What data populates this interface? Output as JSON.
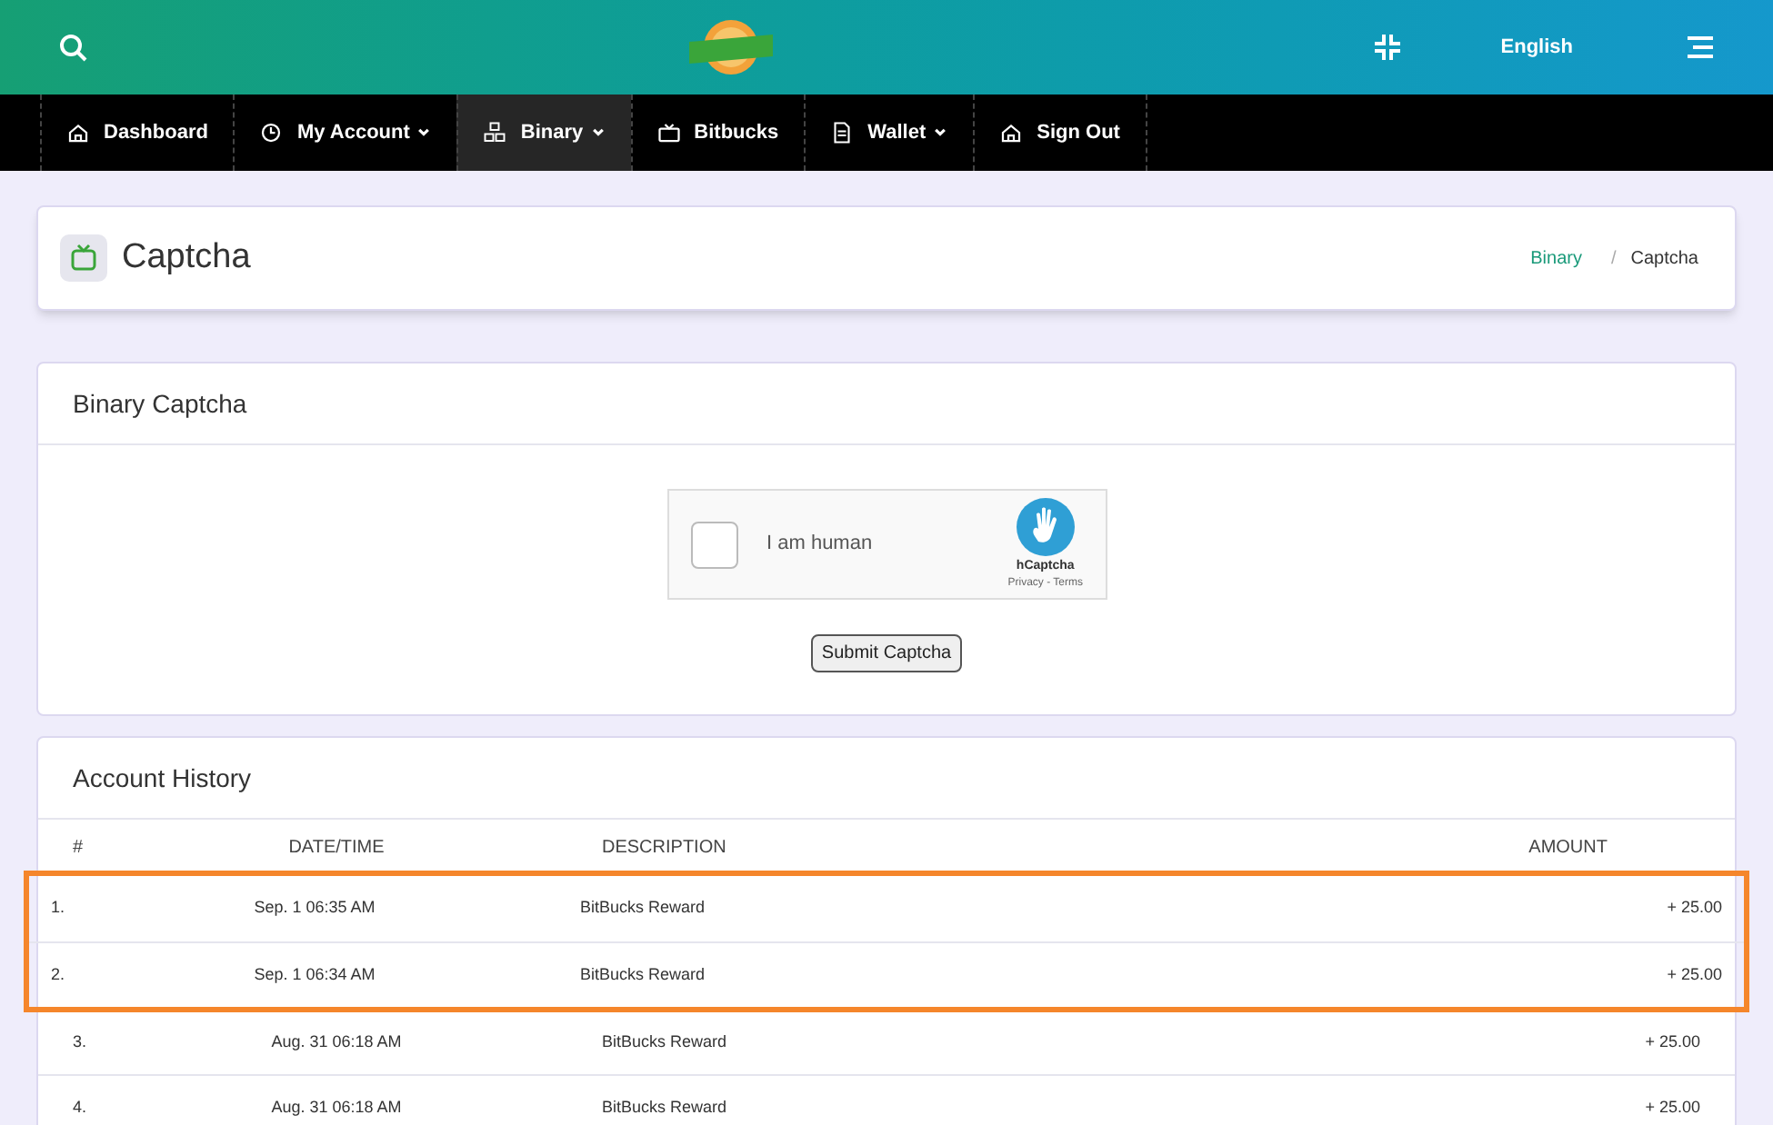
{
  "header": {
    "language": "English"
  },
  "nav": [
    {
      "label": "Dashboard",
      "kind": "home",
      "dropdown": false,
      "selected": false
    },
    {
      "label": "My Account",
      "kind": "clock",
      "dropdown": true,
      "selected": false
    },
    {
      "label": "Binary",
      "kind": "nodes",
      "dropdown": true,
      "selected": true
    },
    {
      "label": "Bitbucks",
      "kind": "tv",
      "dropdown": false,
      "selected": false
    },
    {
      "label": "Wallet",
      "kind": "doc",
      "dropdown": true,
      "selected": false
    },
    {
      "label": "Sign Out",
      "kind": "home",
      "dropdown": false,
      "selected": false
    }
  ],
  "page": {
    "title": "Captcha",
    "breadcrumb": [
      "Binary",
      "Captcha"
    ],
    "breadcrumb_separator": "/"
  },
  "captcha_card": {
    "title": "Binary Captcha",
    "checkbox_label": "I am human",
    "checked": false,
    "provider": "hCaptcha",
    "links": "Privacy - Terms",
    "button": "Submit Captcha"
  },
  "history": {
    "title": "Account History",
    "columns": [
      "#",
      "DATE/TIME",
      "DESCRIPTION",
      "AMOUNT"
    ],
    "rows": [
      {
        "num": "1.",
        "date": "Sep. 1 06:35 AM",
        "description": "BitBucks Reward",
        "amount": "+ 25.00",
        "highlighted": true
      },
      {
        "num": "2.",
        "date": "Sep. 1 06:34 AM",
        "description": "BitBucks Reward",
        "amount": "+ 25.00",
        "highlighted": true
      },
      {
        "num": "3.",
        "date": "Aug. 31 06:18 AM",
        "description": "BitBucks Reward",
        "amount": "+ 25.00",
        "highlighted": false
      },
      {
        "num": "4.",
        "date": "Aug. 31 06:18 AM",
        "description": "BitBucks Reward",
        "amount": "+ 25.00",
        "highlighted": false
      }
    ]
  }
}
